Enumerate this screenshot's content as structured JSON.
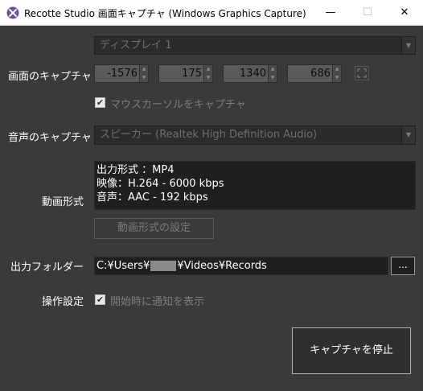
{
  "window": {
    "title": "Recotte Studio 画面キャプチャ (Windows Graphics Capture)",
    "minimize": "—",
    "maximize": "☐",
    "close": "✕"
  },
  "display": {
    "selected": "ディスプレイ 1"
  },
  "screen_capture": {
    "label": "画面のキャプチャ",
    "x": "-1576",
    "y": "175",
    "width": "1340",
    "height": "686",
    "cursor_checkbox_label": "マウスカーソルをキャプチャ",
    "cursor_checked": true
  },
  "audio_capture": {
    "label": "音声のキャプチャ",
    "selected": "スピーカー (Realtek High Definition Audio)"
  },
  "video_format": {
    "label": "動画形式",
    "lines": [
      "出力形式 ：MP4",
      "映像：H.264 - 6000 kbps",
      "音声：AAC - 192 kbps"
    ],
    "settings_button": "動画形式の設定"
  },
  "output_folder": {
    "label": "出力フォルダー",
    "path_prefix": "C:¥Users¥",
    "path_suffix": "¥Videos¥Records",
    "browse_button": "..."
  },
  "operation_settings": {
    "label": "操作設定",
    "notify_checkbox_label": "開始時に通知を表示",
    "notify_checked": true
  },
  "stop_button": "キャプチャを停止",
  "colors": {
    "background": "#3a3a3a",
    "field_dark": "#1f1f1f",
    "text": "#ffffff",
    "disabled_text": "#7c7c7c"
  }
}
